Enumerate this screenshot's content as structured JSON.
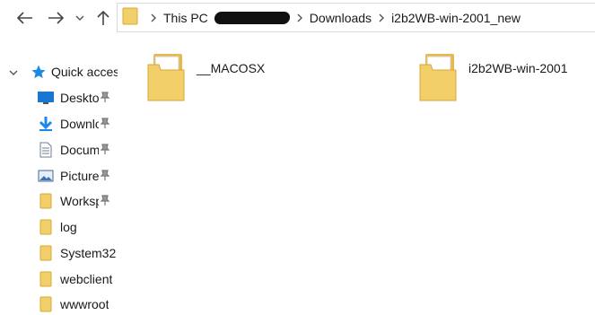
{
  "address_bar": {
    "crumbs": [
      "This PC",
      "Downloads",
      "i2b2WB-win-2001_new"
    ]
  },
  "nav_pane": {
    "quick_access": "Quick access",
    "items": [
      {
        "label": "Desktop",
        "icon": "desktop-icon",
        "pinned": true
      },
      {
        "label": "Downloads",
        "icon": "download-arrow-icon",
        "pinned": true
      },
      {
        "label": "Documents",
        "icon": "document-icon",
        "pinned": true
      },
      {
        "label": "Pictures",
        "icon": "pictures-icon",
        "pinned": true
      },
      {
        "label": "Workspace",
        "icon": "folder-icon",
        "pinned": true
      },
      {
        "label": "log",
        "icon": "folder-icon",
        "pinned": false
      },
      {
        "label": "System32",
        "icon": "folder-icon",
        "pinned": false
      },
      {
        "label": "webclient",
        "icon": "folder-icon",
        "pinned": false
      },
      {
        "label": "wwwroot",
        "icon": "folder-icon",
        "pinned": false
      }
    ]
  },
  "content": {
    "files": [
      {
        "name": "__MACOSX",
        "icon": "folder-icon"
      },
      {
        "name": "i2b2WB-win-2001",
        "icon": "folder-icon"
      }
    ]
  },
  "colors": {
    "folder": "#f3cf6a",
    "folder_back": "#e8b84a",
    "accent": "#1e88e5"
  }
}
